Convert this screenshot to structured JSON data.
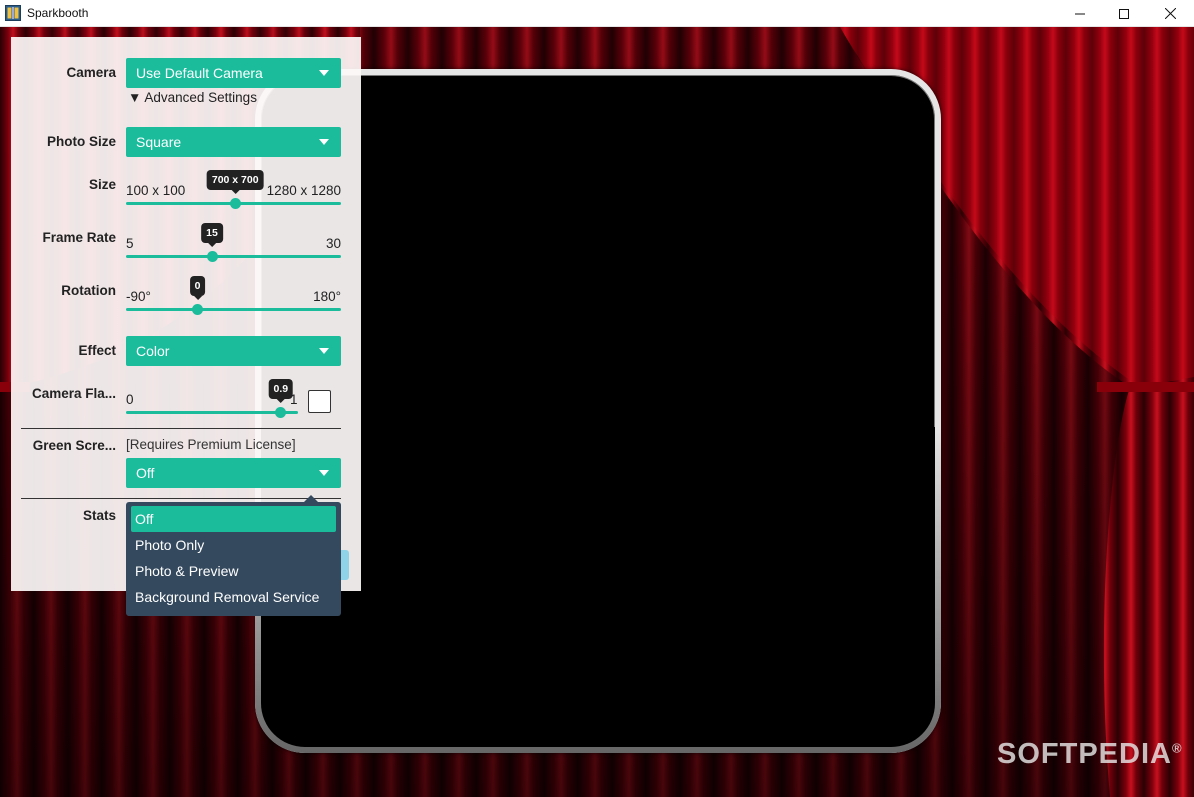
{
  "window": {
    "title": "Sparkbooth"
  },
  "settings": {
    "camera": {
      "label": "Camera",
      "value": "Use Default Camera"
    },
    "advanced_settings": "▼ Advanced Settings",
    "photo_size": {
      "label": "Photo Size",
      "value": "Square"
    },
    "size": {
      "label": "Size",
      "min": "100 x 100",
      "max": "1280 x 1280",
      "value": "700 x 700",
      "fraction": 0.508
    },
    "frame_rate": {
      "label": "Frame Rate",
      "min": "5",
      "max": "30",
      "value": "15",
      "fraction": 0.4
    },
    "rotation": {
      "label": "Rotation",
      "min": "-90°",
      "max": "180°",
      "value": "0",
      "fraction": 0.333
    },
    "effect": {
      "label": "Effect",
      "value": "Color"
    },
    "camera_flash": {
      "label": "Camera Fla...",
      "min": "0",
      "max": "1",
      "value": "0.9",
      "fraction": 0.9,
      "checked": false
    },
    "green_screen": {
      "label": "Green Scre...",
      "note": "[Requires Premium License]",
      "value": "Off",
      "options": [
        "Off",
        "Photo Only",
        "Photo & Preview",
        "Background Removal Service"
      ]
    },
    "stats": {
      "label": "Stats"
    }
  },
  "watermark": {
    "text": "SOFTPEDIA",
    "mark": "®"
  },
  "colors": {
    "accent": "#1abc9c",
    "menu_bg": "#34495e",
    "curtain": "#b00010"
  }
}
